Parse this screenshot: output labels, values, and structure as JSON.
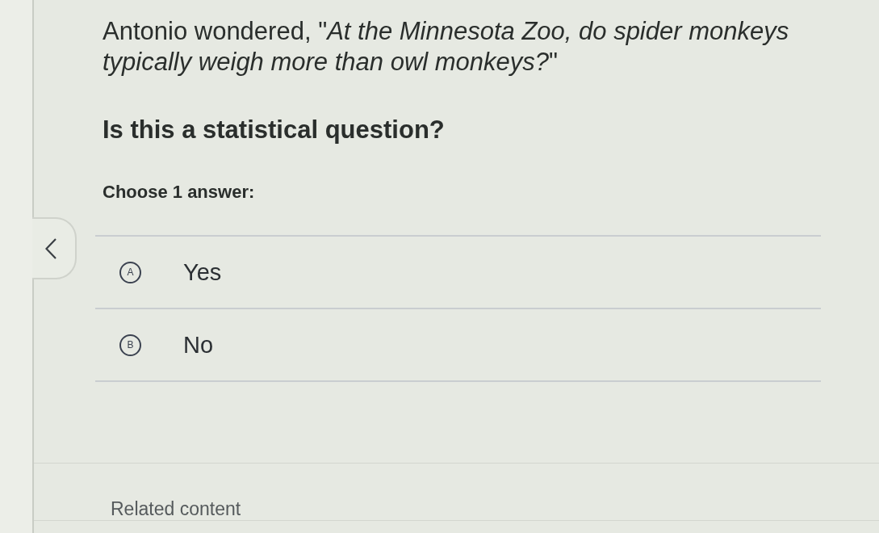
{
  "question": {
    "prompt": "Antonio wondered, \"*At the Minnesota Zoo, do spider monkeys typically weigh more than owl monkeys?*\"",
    "heading": "Is this a statistical question?",
    "instruction": "Choose 1 answer:"
  },
  "choices": [
    {
      "letter": "A",
      "label": "Yes",
      "selected": false
    },
    {
      "letter": "B",
      "label": "No",
      "selected": false
    }
  ],
  "related": {
    "heading": "Related content"
  }
}
